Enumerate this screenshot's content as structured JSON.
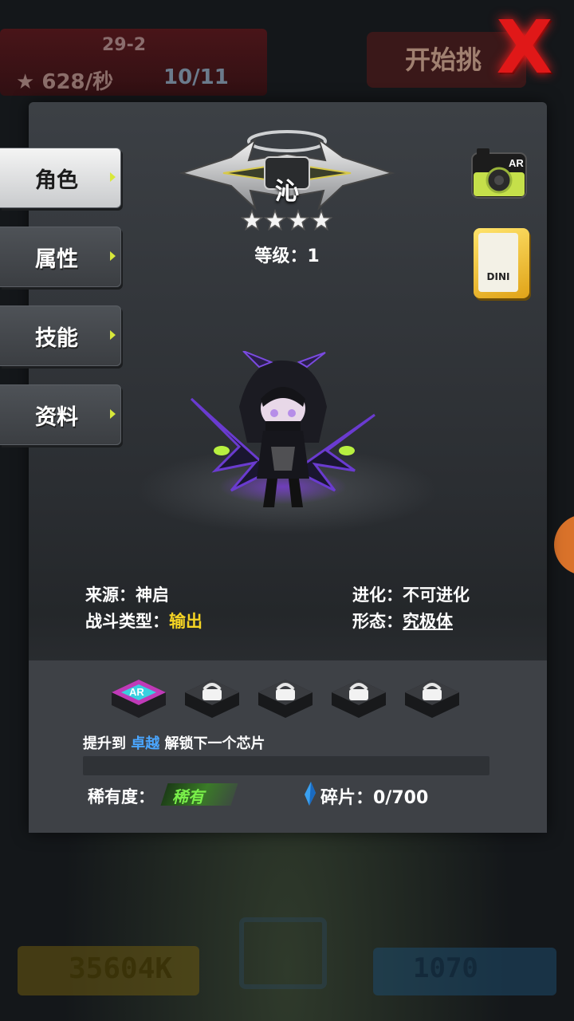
{
  "background": {
    "stage": "29-2",
    "rate": "628/秒",
    "mice": "10/11",
    "start_label": "开始挑",
    "gold": "35604K",
    "gems": "1070"
  },
  "close_label": "X",
  "tabs": [
    {
      "label": "角色",
      "active": true
    },
    {
      "label": "属性",
      "active": false
    },
    {
      "label": "技能",
      "active": false
    },
    {
      "label": "资料",
      "active": false
    }
  ],
  "character": {
    "name": "沁",
    "star_count": 4,
    "level": "等级：1"
  },
  "ar_label": "AR",
  "dini_label": "DINI",
  "info": {
    "source_label": "来源：",
    "source_value": "神启",
    "evolve_label": "进化：",
    "evolve_value": "不可进化",
    "battle_label": "战斗类型：",
    "battle_value": "输出",
    "form_label": "形态：",
    "form_value": "究极体"
  },
  "chips": {
    "unlocked_label": "AR",
    "locked_count": 4
  },
  "unlock": {
    "prefix": "提升到 ",
    "rank": "卓越",
    "suffix": " 解锁下一个芯片"
  },
  "progress": 0,
  "rarity": {
    "label": "稀有度：",
    "value": "稀有"
  },
  "shards": "碎片：0/700",
  "colors": {
    "accent_yellow": "#f5d424",
    "rank_blue": "#4aa6ff",
    "rarity_green": "#7af04a",
    "close_red": "#e01818"
  }
}
